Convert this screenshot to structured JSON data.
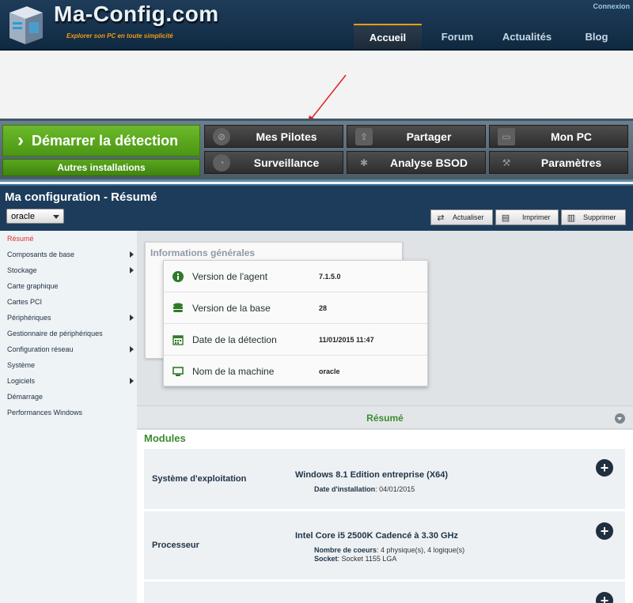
{
  "header": {
    "logo_title": "Ma-Config.com",
    "logo_tagline": "Explorer son PC en toute simplicité",
    "connexion": "Connexion",
    "nav": [
      {
        "label": "Accueil",
        "active": true
      },
      {
        "label": "Forum",
        "active": false
      },
      {
        "label": "Actualités",
        "active": false
      },
      {
        "label": "Blog",
        "active": false
      }
    ]
  },
  "toolbar": {
    "start_detection": "Démarrer la détection",
    "other_installs": "Autres installations",
    "buttons": [
      {
        "label": "Mes Pilotes",
        "icon": "compass-icon"
      },
      {
        "label": "Partager",
        "icon": "share-icon"
      },
      {
        "label": "Mon PC",
        "icon": "monitor-icon"
      },
      {
        "label": "Surveillance",
        "icon": "gauge-icon"
      },
      {
        "label": "Analyse BSOD",
        "icon": "bug-icon"
      },
      {
        "label": "Paramètres",
        "icon": "wrench-icon"
      }
    ]
  },
  "config": {
    "title": "Ma configuration - Résumé",
    "machine_selected": "oracle",
    "actions": {
      "refresh": "Actualiser",
      "print": "Imprimer",
      "delete": "Supprimer"
    }
  },
  "sidebar": {
    "items": [
      {
        "label": "Résumé",
        "active": true,
        "submenu": false
      },
      {
        "label": "Composants de base",
        "active": false,
        "submenu": true
      },
      {
        "label": "Stockage",
        "active": false,
        "submenu": true
      },
      {
        "label": "Carte graphique",
        "active": false,
        "submenu": false
      },
      {
        "label": "Cartes PCI",
        "active": false,
        "submenu": false
      },
      {
        "label": "Périphériques",
        "active": false,
        "submenu": true
      },
      {
        "label": "Gestionnaire de périphériques",
        "active": false,
        "submenu": false
      },
      {
        "label": "Configuration réseau",
        "active": false,
        "submenu": true
      },
      {
        "label": "Système",
        "active": false,
        "submenu": false
      },
      {
        "label": "Logiciels",
        "active": false,
        "submenu": true
      },
      {
        "label": "Démarrage",
        "active": false,
        "submenu": false
      },
      {
        "label": "Performances Windows",
        "active": false,
        "submenu": false
      }
    ]
  },
  "info": {
    "title": "Informations générales",
    "rows": [
      {
        "label": "Version de l'agent",
        "value": "7.1.5.0",
        "icon": "info-icon"
      },
      {
        "label": "Version de la base",
        "value": "28",
        "icon": "database-icon"
      },
      {
        "label": "Date de la détection",
        "value": "11/01/2015 11:47",
        "icon": "calendar-icon"
      },
      {
        "label": "Nom de la machine",
        "value": "oracle",
        "icon": "monitor-icon"
      }
    ]
  },
  "resume": {
    "label": "Résumé"
  },
  "modules": {
    "title": "Modules",
    "items": [
      {
        "name": "Système d'exploitation",
        "title": "Windows 8.1 Edition entreprise (X64)",
        "details": [
          {
            "key": "Date d'installation",
            "value": "04/01/2015"
          }
        ]
      },
      {
        "name": "Processeur",
        "title": "Intel Core i5 2500K Cadencé à 3.30 GHz",
        "details": [
          {
            "key": "Nombre de coeurs",
            "value": "4 physique(s), 4 logique(s)"
          },
          {
            "key": "Socket",
            "value": "Socket 1155 LGA"
          }
        ]
      }
    ]
  },
  "colors": {
    "header_bg": "#16324c",
    "accent_orange": "#f39b12",
    "start_green": "#5aa71e",
    "section_green": "#3b8c2e",
    "active_red": "#d8352a"
  }
}
